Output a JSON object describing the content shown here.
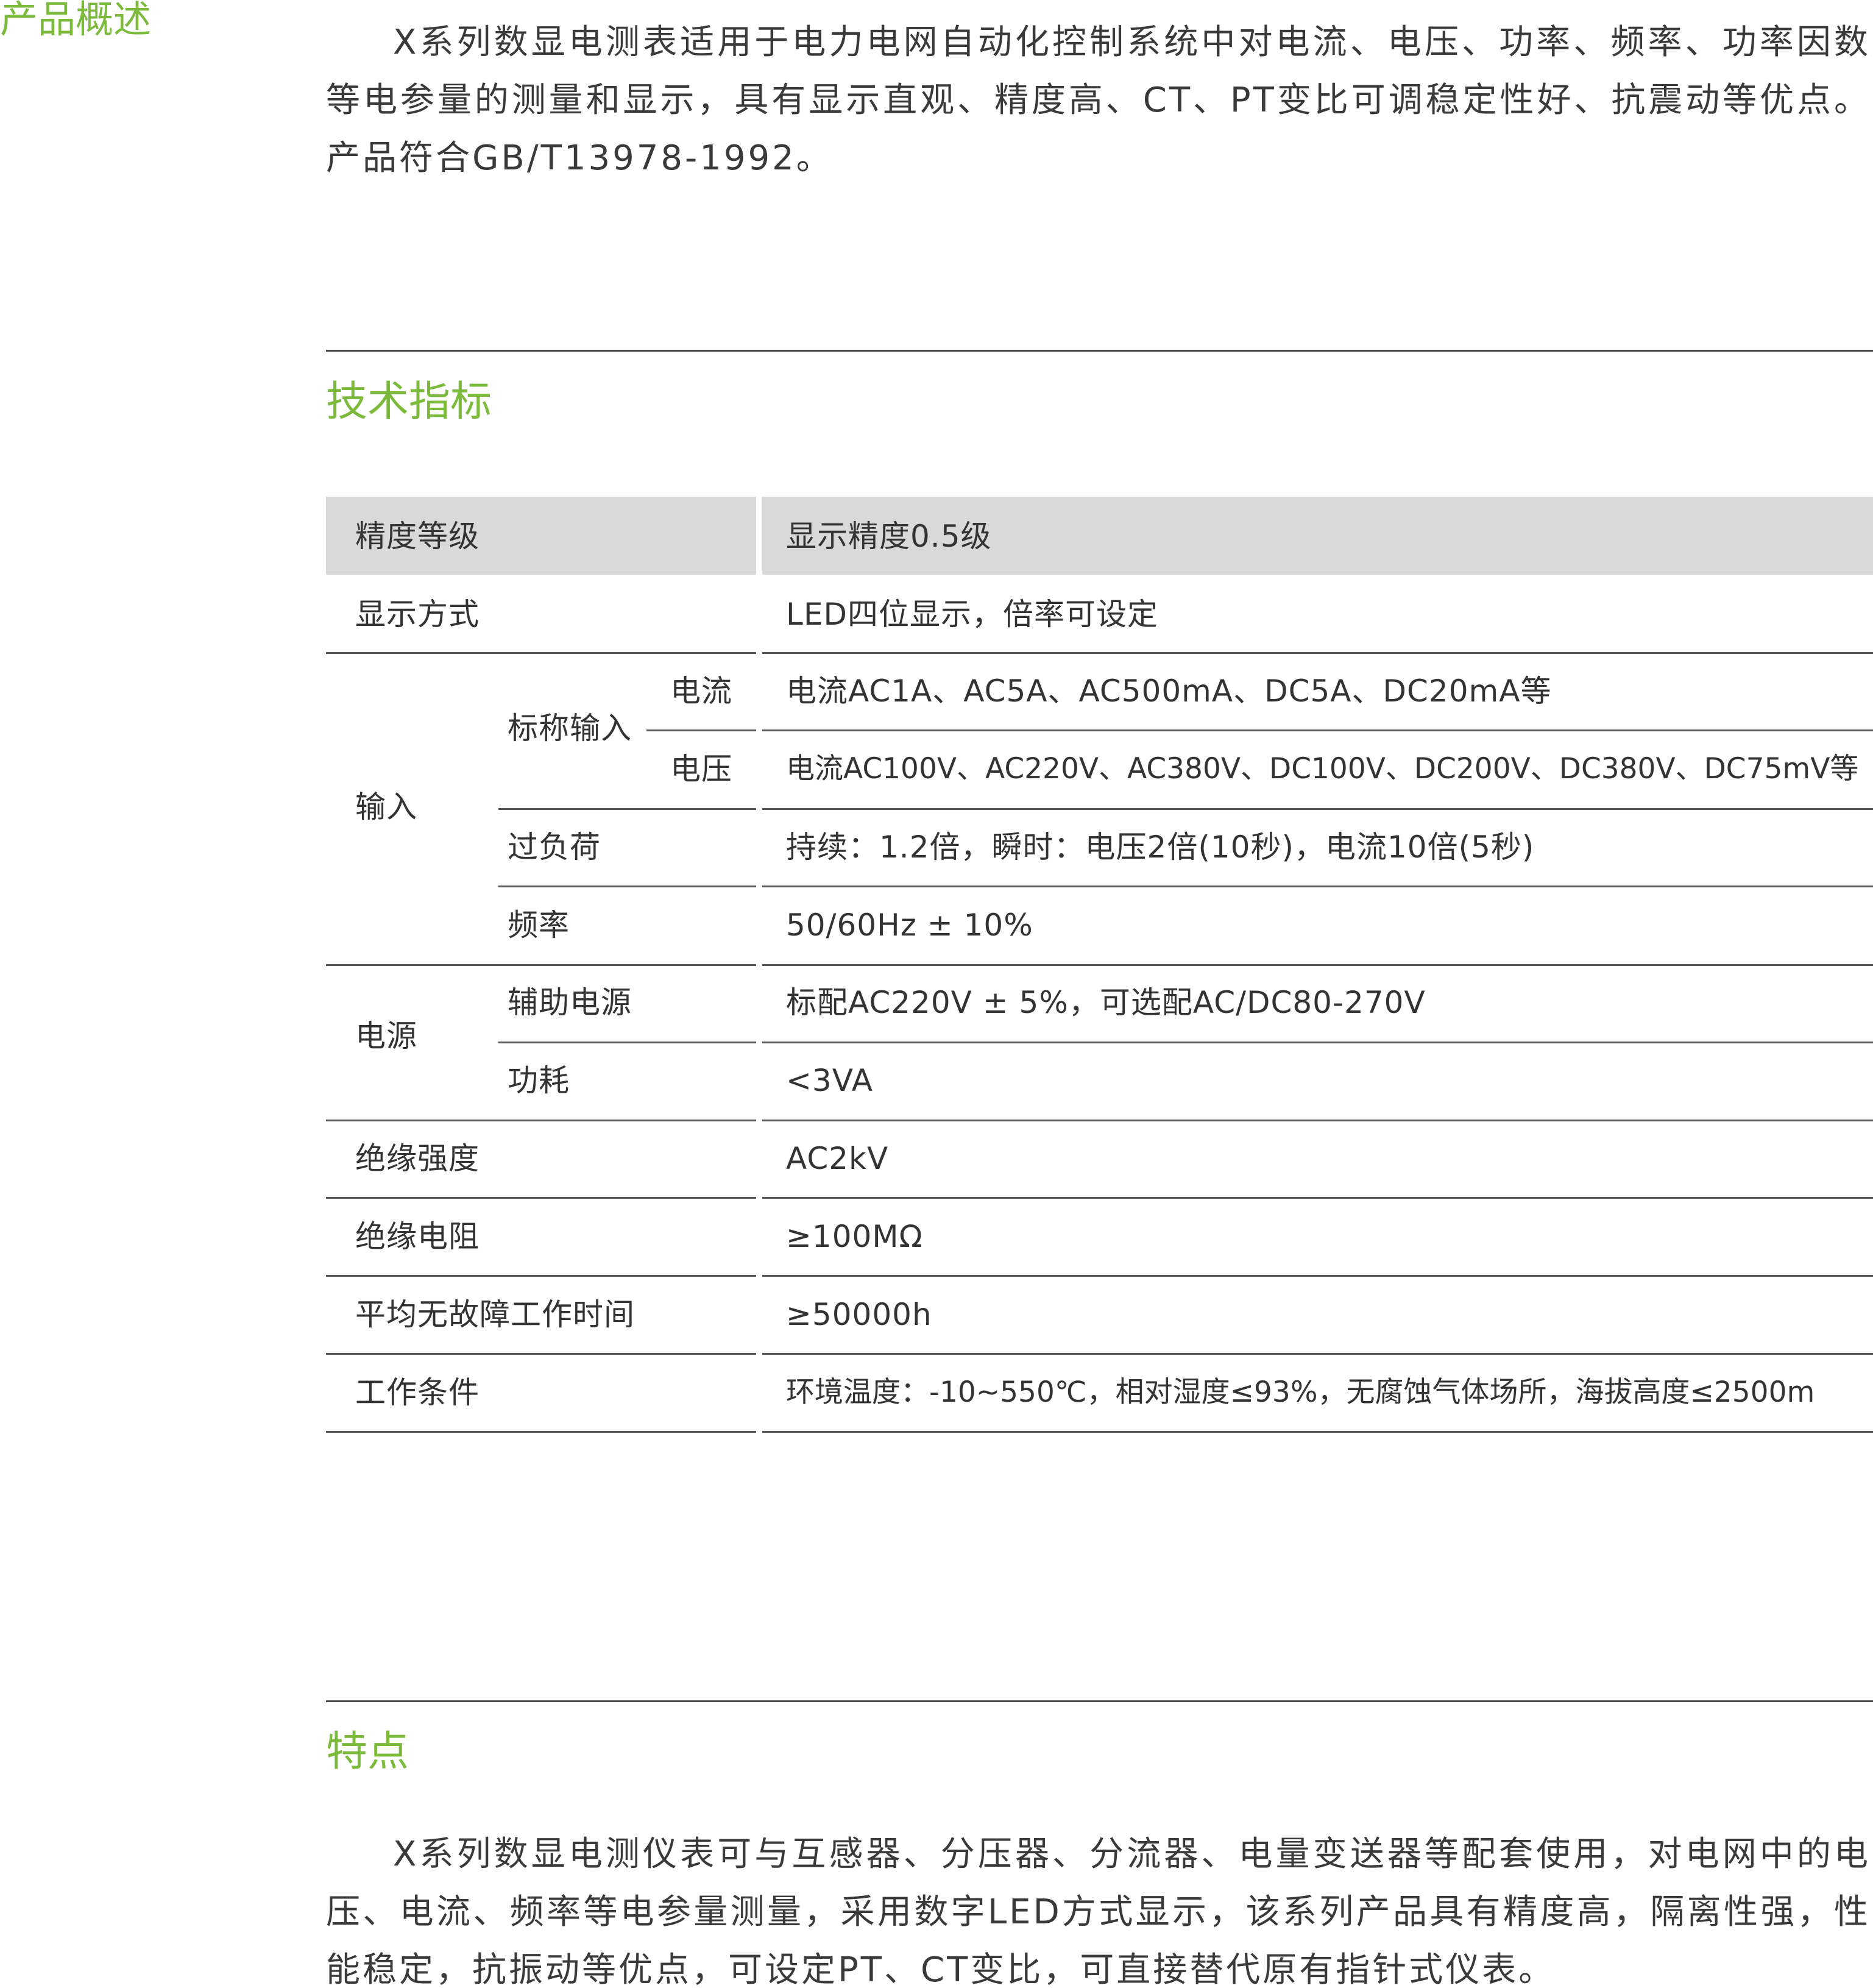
{
  "overview": {
    "heading": "产品概述",
    "body": "X系列数显电测表适用于电力电网自动化控制系统中对电流、电压、功率、频率、功率因数等电参量的测量和显示，具有显示直观、精度高、CT、PT变比可调稳定性好、抗震动等优点。产品符合GB/T13978-1992。"
  },
  "specs": {
    "heading": "技术指标",
    "header": {
      "label": "精度等级",
      "value": "显示精度0.5级"
    },
    "display": {
      "label": "显示方式",
      "value": "LED四位显示，倍率可设定"
    },
    "input": {
      "label": "输入",
      "nominal_label": "标称输入",
      "current_label": "电流",
      "current_value": "电流AC1A、AC5A、AC500mA、DC5A、DC20mA等",
      "voltage_label": "电压",
      "voltage_value": "电流AC100V、AC220V、AC380V、DC100V、DC200V、DC380V、DC75mV等",
      "overload_label": "过负荷",
      "overload_value": "持续：1.2倍，瞬时：电压2倍(10秒)，电流10倍(5秒)",
      "frequency_label": "频率",
      "frequency_value": "50/60Hz ± 10%"
    },
    "power": {
      "label": "电源",
      "aux_label": "辅助电源",
      "aux_value": "标配AC220V ± 5%，可选配AC/DC80-270V",
      "consumption_label": "功耗",
      "consumption_value": "<3VA"
    },
    "insulation_strength": {
      "label": "绝缘强度",
      "value": "AC2kV"
    },
    "insulation_resistance": {
      "label": "绝缘电阻",
      "value": "≥100MΩ"
    },
    "mtbf": {
      "label": "平均无故障工作时间",
      "value": "≥50000h"
    },
    "conditions": {
      "label": "工作条件",
      "value": "环境温度：-10~550℃，相对湿度≤93%，无腐蚀气体场所，海拔高度≤2500m"
    }
  },
  "features": {
    "heading": "特点",
    "body": "X系列数显电测仪表可与互感器、分压器、分流器、电量变送器等配套使用，对电网中的电压、电流、频率等电参量测量，采用数字LED方式显示，该系列产品具有精度高，隔离性强，性能稳定，抗振动等优点，可设定PT、CT变比，可直接替代原有指针式仪表。"
  }
}
